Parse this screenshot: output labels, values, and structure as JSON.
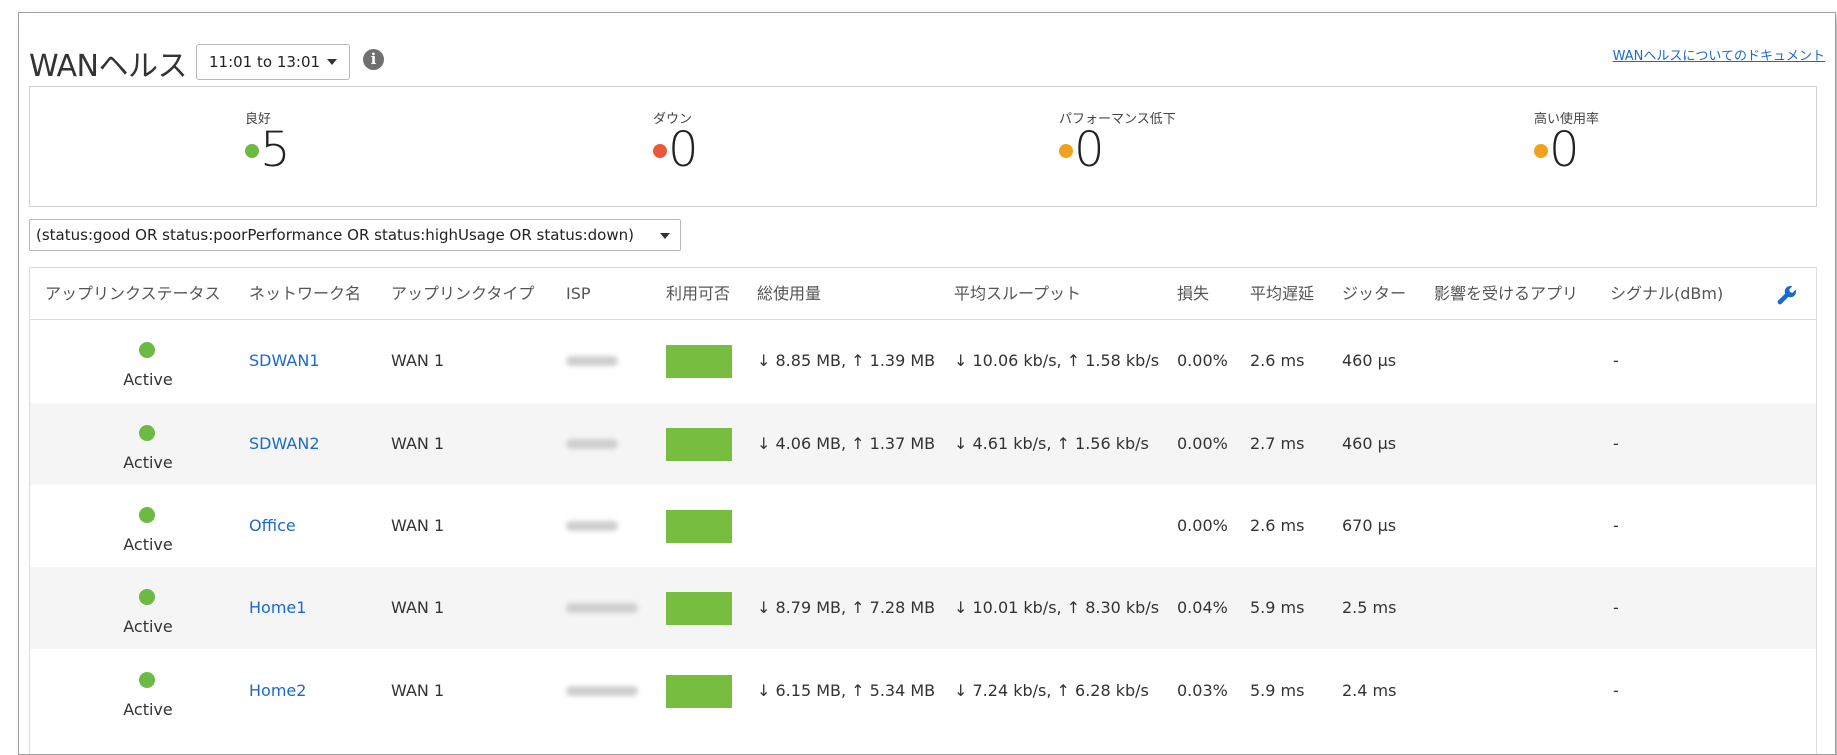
{
  "header": {
    "title": "WANヘルス",
    "time_range": "11:01 to 13:01",
    "doc_link": "WANヘルスについてのドキュメント",
    "info_icon": "info-icon"
  },
  "summary": {
    "good": {
      "label": "良好",
      "value": "5",
      "color": "#6cb944"
    },
    "down": {
      "label": "ダウン",
      "value": "0",
      "color": "#e85a3a"
    },
    "degraded": {
      "label": "パフォーマンス低下",
      "value": "0",
      "color": "#f0a21e"
    },
    "high_usage": {
      "label": "高い使用率",
      "value": "0",
      "color": "#f0a21e"
    }
  },
  "filter": {
    "value": "(status:good OR status:poorPerformance OR status:highUsage OR status:down)"
  },
  "table": {
    "columns": [
      "アップリンクステータス",
      "ネットワーク名",
      "アップリンクタイプ",
      "ISP",
      "利用可否",
      "総使用量",
      "平均スループット",
      "損失",
      "平均遅延",
      "ジッター",
      "影響を受けるアプリ",
      "シグナル(dBm)"
    ],
    "settings_icon": "wrench-icon",
    "status_color": "#6cb944",
    "availability_color": "#77bd3f",
    "rows": [
      {
        "status": "Active",
        "network": "SDWAN1",
        "uplink": "WAN 1",
        "usage": "↓ 8.85 MB, ↑ 1.39 MB",
        "throughput": "↓ 10.06 kb/s, ↑ 1.58 kb/s",
        "loss": "0.00%",
        "latency": "2.6 ms",
        "jitter": "460 µs",
        "apps": "",
        "signal": "-",
        "availability": 1.0
      },
      {
        "status": "Active",
        "network": "SDWAN2",
        "uplink": "WAN 1",
        "usage": "↓ 4.06 MB, ↑ 1.37 MB",
        "throughput": "↓ 4.61 kb/s, ↑ 1.56 kb/s",
        "loss": "0.00%",
        "latency": "2.7 ms",
        "jitter": "460 µs",
        "apps": "",
        "signal": "-",
        "availability": 1.0
      },
      {
        "status": "Active",
        "network": "Office",
        "uplink": "WAN 1",
        "usage": "",
        "throughput": "",
        "loss": "0.00%",
        "latency": "2.6 ms",
        "jitter": "670 µs",
        "apps": "",
        "signal": "-",
        "availability": 1.0
      },
      {
        "status": "Active",
        "network": "Home1",
        "uplink": "WAN 1",
        "usage": "↓ 8.79 MB, ↑ 7.28 MB",
        "throughput": "↓ 10.01 kb/s, ↑ 8.30 kb/s",
        "loss": "0.04%",
        "latency": "5.9 ms",
        "jitter": "2.5 ms",
        "apps": "",
        "signal": "-",
        "availability": 1.0
      },
      {
        "status": "Active",
        "network": "Home2",
        "uplink": "WAN 1",
        "usage": "↓ 6.15 MB, ↑ 5.34 MB",
        "throughput": "↓ 7.24 kb/s, ↑ 6.28 kb/s",
        "loss": "0.03%",
        "latency": "5.9 ms",
        "jitter": "2.4 ms",
        "apps": "",
        "signal": "-",
        "availability": 1.0
      }
    ]
  }
}
